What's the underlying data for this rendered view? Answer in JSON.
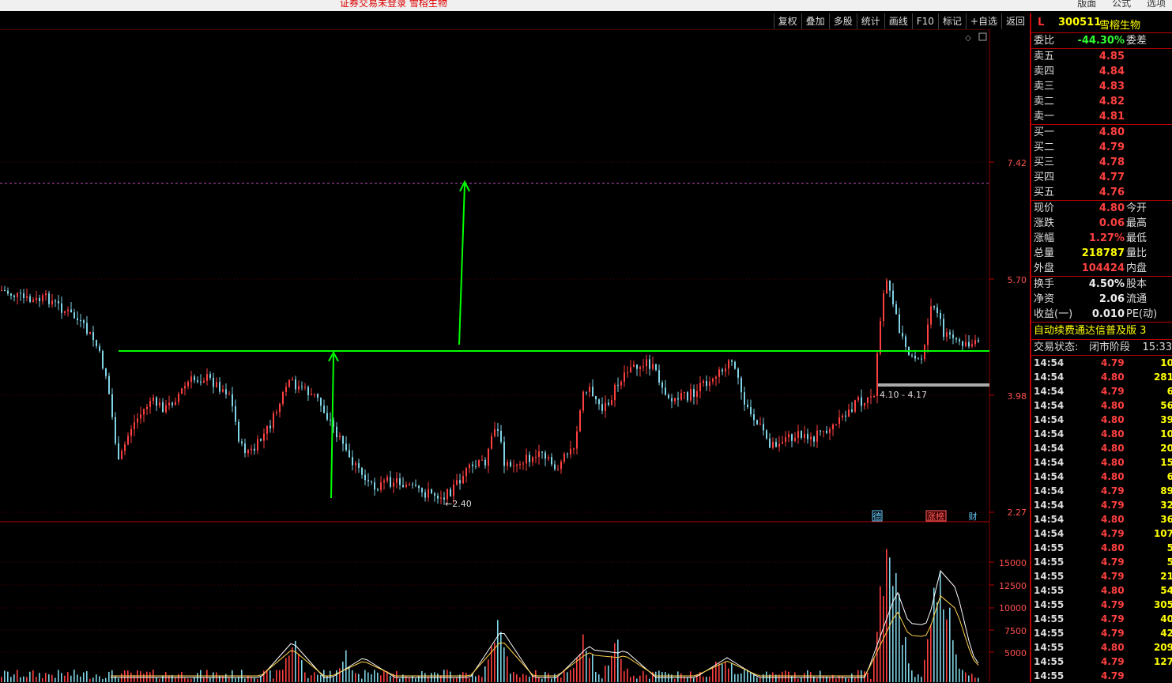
{
  "topbar": {
    "status": "证券交易未登录   雪榕生物",
    "menus": [
      "版面",
      "公式",
      "选项"
    ]
  },
  "toolbar": [
    "复权",
    "叠加",
    "多股",
    "统计",
    "画线",
    "F10",
    "标记",
    "+自选",
    "返回"
  ],
  "chart_data": [
    {
      "type": "line",
      "yticks": [
        "7.42",
        "5.70",
        "3.98",
        "2.27"
      ],
      "annotations": [
        "←2.40",
        "4.10 - 4.17"
      ],
      "markers": [
        "德",
        "涨榜",
        "财"
      ],
      "colors": {
        "up": "#ff4040",
        "down": "#7fd4e6",
        "trendline": "#00ff00",
        "arrow": "#00ff00",
        "dashed": "#c050c0"
      }
    },
    {
      "type": "bar",
      "yticks": [
        "15000",
        "12500",
        "10000",
        "7500",
        "5000"
      ]
    }
  ],
  "quote": {
    "marker": "L",
    "code": "300511",
    "name": "雪榕生物",
    "weibi_label": "委比",
    "weibi_value": "-44.30%",
    "weicha_label": "委差",
    "sells": [
      {
        "label": "卖五",
        "price": "4.85"
      },
      {
        "label": "卖四",
        "price": "4.84"
      },
      {
        "label": "卖三",
        "price": "4.83"
      },
      {
        "label": "卖二",
        "price": "4.82"
      },
      {
        "label": "卖一",
        "price": "4.81"
      }
    ],
    "buys": [
      {
        "label": "买一",
        "price": "4.80"
      },
      {
        "label": "买二",
        "price": "4.79"
      },
      {
        "label": "买三",
        "price": "4.78"
      },
      {
        "label": "买四",
        "price": "4.77"
      },
      {
        "label": "买五",
        "price": "4.76"
      }
    ],
    "stats1": [
      {
        "label": "现价",
        "value": "4.80",
        "label2": "今开"
      },
      {
        "label": "涨跌",
        "value": "0.06",
        "label2": "最高"
      },
      {
        "label": "涨幅",
        "value": "1.27%",
        "label2": "最低"
      },
      {
        "label": "总量",
        "value": "218787",
        "label2": "量比"
      },
      {
        "label": "外盘",
        "value": "104424",
        "label2": "内盘"
      }
    ],
    "stats2": [
      {
        "label": "换手",
        "value": "4.50%",
        "label2": "股本"
      },
      {
        "label": "净资",
        "value": "2.06",
        "label2": "流通"
      },
      {
        "label": "收益(一)",
        "value": "0.010",
        "label2": "PE(动)"
      }
    ],
    "notice": "自动续费通达信普及版  3",
    "trade_state_label": "交易状态:",
    "trade_state": "闭市阶段",
    "trade_time": "15:33"
  },
  "ticks": [
    {
      "t": "14:54",
      "p": "4.79",
      "v": "10"
    },
    {
      "t": "14:54",
      "p": "4.80",
      "v": "281"
    },
    {
      "t": "14:54",
      "p": "4.79",
      "v": "6"
    },
    {
      "t": "14:54",
      "p": "4.80",
      "v": "56"
    },
    {
      "t": "14:54",
      "p": "4.80",
      "v": "39"
    },
    {
      "t": "14:54",
      "p": "4.80",
      "v": "10"
    },
    {
      "t": "14:54",
      "p": "4.80",
      "v": "20"
    },
    {
      "t": "14:54",
      "p": "4.80",
      "v": "15"
    },
    {
      "t": "14:54",
      "p": "4.80",
      "v": "6"
    },
    {
      "t": "14:54",
      "p": "4.79",
      "v": "89"
    },
    {
      "t": "14:54",
      "p": "4.79",
      "v": "32"
    },
    {
      "t": "14:54",
      "p": "4.80",
      "v": "36"
    },
    {
      "t": "14:54",
      "p": "4.79",
      "v": "107"
    },
    {
      "t": "14:55",
      "p": "4.80",
      "v": "5"
    },
    {
      "t": "14:55",
      "p": "4.79",
      "v": "5"
    },
    {
      "t": "14:55",
      "p": "4.79",
      "v": "21"
    },
    {
      "t": "14:55",
      "p": "4.80",
      "v": "54"
    },
    {
      "t": "14:55",
      "p": "4.79",
      "v": "305"
    },
    {
      "t": "14:55",
      "p": "4.79",
      "v": "40"
    },
    {
      "t": "14:55",
      "p": "4.79",
      "v": "42"
    },
    {
      "t": "14:55",
      "p": "4.80",
      "v": "209"
    },
    {
      "t": "14:55",
      "p": "4.79",
      "v": "127"
    },
    {
      "t": "14:55",
      "p": "4.79",
      "v": ""
    }
  ]
}
